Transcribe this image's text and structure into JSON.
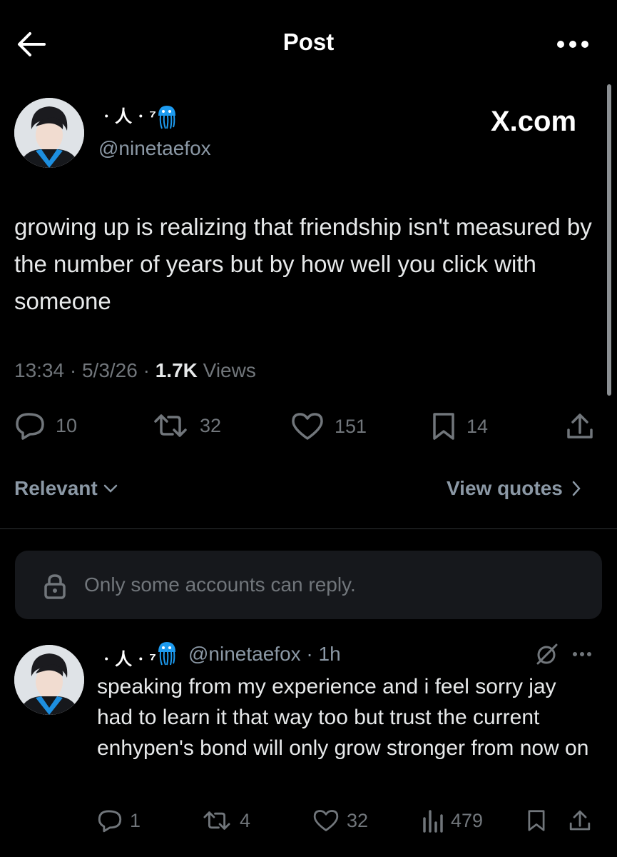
{
  "header": {
    "title": "Post"
  },
  "post": {
    "author": {
      "display_name": "ㆍ人ㆍ⁷",
      "handle": "@ninetaefox"
    },
    "watermark": "X.com",
    "text": "growing up is realizing that friendship isn't measured by the number of years but by how well you click with someone",
    "time": "13:34",
    "date": "5/3/26",
    "views_count": "1.7K",
    "views_label": "Views",
    "stats": {
      "replies": "10",
      "reposts": "32",
      "likes": "151",
      "bookmarks": "14"
    }
  },
  "sort": {
    "label": "Relevant",
    "quotes_label": "View quotes"
  },
  "notice": {
    "text": "Only some accounts can reply."
  },
  "reply": {
    "author": {
      "display_name": "ㆍ人ㆍ⁷",
      "handle": "@ninetaefox",
      "time": "1h"
    },
    "text": "speaking from my experience and i feel sorry jay had to learn it that way too but trust the current enhypen's bond will only grow stronger from now on",
    "stats": {
      "replies": "1",
      "reposts": "4",
      "likes": "32",
      "views": "479"
    }
  },
  "icons": {
    "back": "arrow-left-icon",
    "more": "more-horizontal-icon",
    "verified": "jellyfish-emoji-icon",
    "reply": "speech-bubble-icon",
    "repost": "repost-arrows-icon",
    "like": "heart-icon",
    "bookmark": "bookmark-icon",
    "share": "share-upload-icon",
    "lock": "lock-icon",
    "views": "bar-chart-icon",
    "grok": "slashed-circle-icon"
  },
  "colors": {
    "background": "#000000",
    "text": "#e7e9ea",
    "muted": "#71767b",
    "notice_bg": "#16181c",
    "jellyfish": "#1d9bf0"
  }
}
